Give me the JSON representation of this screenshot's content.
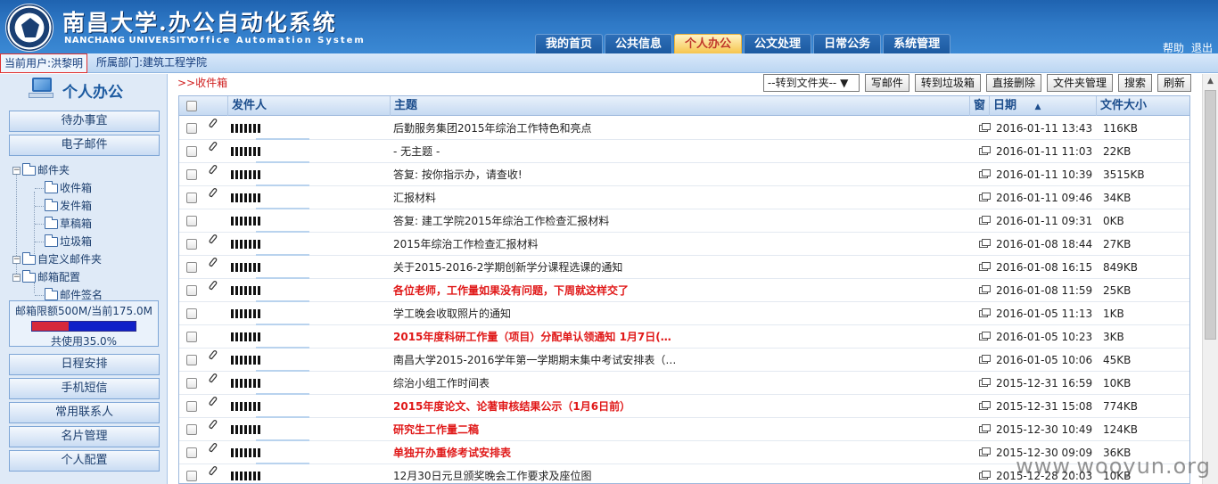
{
  "header": {
    "title_cn": "南昌大学.办公自动化系统",
    "title_en_left": "NANCHANG UNIVERSITY",
    "title_en_right": "Office Automation System",
    "tabs": [
      "我的首页",
      "公共信息",
      "个人办公",
      "公文处理",
      "日常公务",
      "系统管理"
    ],
    "active_tab": "个人办公",
    "links": [
      "帮助",
      "退出"
    ]
  },
  "infobar": {
    "current_user": "当前用户:洪黎明",
    "department": "所属部门:建筑工程学院"
  },
  "sidebar": {
    "title": "个人办公",
    "top_buttons": [
      "待办事宜",
      "电子邮件"
    ],
    "tree": {
      "mail_folders": "邮件夹",
      "inbox": "收件箱",
      "sent": "发件箱",
      "drafts": "草稿箱",
      "trash": "垃圾箱",
      "custom_folders": "自定义邮件夹",
      "mailbox_config": "邮箱配置",
      "signature": "邮件签名"
    },
    "quota": {
      "limit_text": "邮箱限额500M/当前175.0M",
      "used_text": "共使用35.0%",
      "used_fraction": 0.35
    },
    "bottom_buttons": [
      "日程安排",
      "手机短信",
      "常用联系人",
      "名片管理",
      "个人配置"
    ]
  },
  "main": {
    "breadcrumb": ">>收件箱",
    "move_select": "--转到文件夹--",
    "toolbar": [
      "写邮件",
      "转到垃圾箱",
      "直接删除",
      "文件夹管理",
      "搜索",
      "刷新"
    ],
    "columns": {
      "sender": "发件人",
      "subject": "主题",
      "window": "窗",
      "date": "日期",
      "size": "文件大小"
    },
    "rows": [
      {
        "attach": true,
        "subject": "后勤服务集团2015年综治工作特色和亮点",
        "bold": false,
        "date": "2016-01-11 13:43",
        "size": "116KB"
      },
      {
        "attach": true,
        "subject": "- 无主题 -",
        "bold": false,
        "date": "2016-01-11 11:03",
        "size": "22KB"
      },
      {
        "attach": true,
        "subject": "答复: 按你指示办，请查收!",
        "bold": false,
        "date": "2016-01-11 10:39",
        "size": "3515KB"
      },
      {
        "attach": true,
        "subject": "汇报材料",
        "bold": false,
        "date": "2016-01-11 09:46",
        "size": "34KB"
      },
      {
        "attach": false,
        "subject": "答复: 建工学院2015年综治工作检查汇报材料",
        "bold": false,
        "date": "2016-01-11 09:31",
        "size": "0KB"
      },
      {
        "attach": true,
        "subject": "2015年综治工作检查汇报材料",
        "bold": false,
        "date": "2016-01-08 18:44",
        "size": "27KB"
      },
      {
        "attach": true,
        "subject": "关于2015-2016-2学期创新学分课程选课的通知",
        "bold": false,
        "date": "2016-01-08 16:15",
        "size": "849KB"
      },
      {
        "attach": true,
        "subject": "各位老师，工作量如果没有问题，下周就这样交了",
        "bold": true,
        "date": "2016-01-08 11:59",
        "size": "25KB"
      },
      {
        "attach": false,
        "subject": "学工晚会收取照片的通知",
        "bold": false,
        "date": "2016-01-05 11:13",
        "size": "1KB"
      },
      {
        "attach": false,
        "subject": "2015年度科研工作量（项目）分配单认领通知 1月7日(…",
        "bold": true,
        "date": "2016-01-05 10:23",
        "size": "3KB"
      },
      {
        "attach": true,
        "subject": "南昌大学2015-2016学年第一学期期末集中考试安排表（…",
        "bold": false,
        "date": "2016-01-05 10:06",
        "size": "45KB"
      },
      {
        "attach": true,
        "subject": "综治小组工作时间表",
        "bold": false,
        "date": "2015-12-31 16:59",
        "size": "10KB"
      },
      {
        "attach": true,
        "subject": "2015年度论文、论著审核结果公示（1月6日前）",
        "bold": true,
        "date": "2015-12-31 15:08",
        "size": "774KB"
      },
      {
        "attach": true,
        "subject": "研究生工作量二稿",
        "bold": true,
        "date": "2015-12-30 10:49",
        "size": "124KB"
      },
      {
        "attach": true,
        "subject": "单独开办重修考试安排表",
        "bold": true,
        "date": "2015-12-30 09:09",
        "size": "36KB"
      },
      {
        "attach": true,
        "subject": "12月30日元旦颁奖晚会工作要求及座位图",
        "bold": false,
        "date": "2015-12-28 20:03",
        "size": "10KB"
      }
    ]
  },
  "watermark": "www.wooyun.org",
  "colors": {
    "header_blue": "#2f79c6",
    "active_tab_text": "#c0392b",
    "unread_red": "#e01818",
    "quota_used": "#d6283b",
    "quota_free": "#1020c8"
  }
}
